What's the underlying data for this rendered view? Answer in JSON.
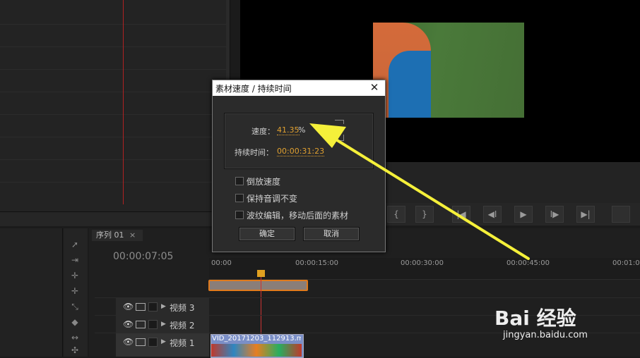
{
  "dialog": {
    "title": "素材速度 / 持续时间",
    "speed_label": "速度：",
    "speed_value": "41.35",
    "speed_unit": "%",
    "duration_label": "持续时间：",
    "duration_value": "00:00:31:23",
    "options": [
      "倒放速度",
      "保持音调不变",
      "波纹编辑，移动后面的素材"
    ],
    "ok_label": "确定",
    "cancel_label": "取消",
    "close_glyph": "✕",
    "link_glyph": "⚭"
  },
  "timeline": {
    "sequence_tab": "序列 01",
    "sequence_close": "×",
    "timecode": "00:00:07:05",
    "ruler_labels": [
      "00:00",
      "00:00:15:00",
      "00:00:30:00",
      "00:00:45:00",
      "00:01:0"
    ],
    "tracks": [
      {
        "label": "视频 3"
      },
      {
        "label": "视频 2"
      },
      {
        "label": "视频 1"
      }
    ],
    "clip_name": "VID_20171203_112913.m"
  },
  "icons": {
    "eye": "👁",
    "expand": "▶",
    "play": "▶",
    "step_back": "◀I",
    "step_forward": "I▶",
    "go_in": "{",
    "go_out": "}",
    "goto_in": "|◀",
    "goto_out": "▶|"
  },
  "watermark": {
    "logo": "Bai 经验",
    "url": "jingyan.baidu.com"
  },
  "colors": {
    "accent_value": "#e0a030",
    "playhead": "#cc3333",
    "annotation_arrow": "#f5f03a"
  }
}
